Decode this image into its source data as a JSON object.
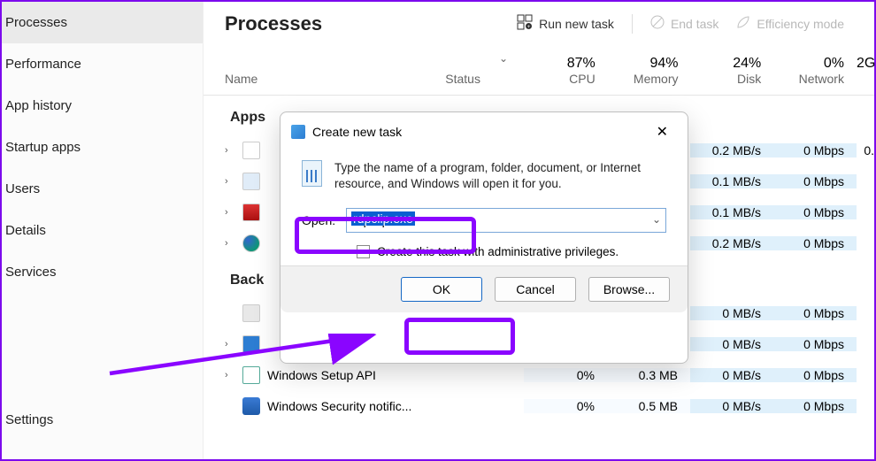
{
  "sidebar": {
    "items": [
      {
        "label": "Processes"
      },
      {
        "label": "Performance"
      },
      {
        "label": "App history"
      },
      {
        "label": "Startup apps"
      },
      {
        "label": "Users"
      },
      {
        "label": "Details"
      },
      {
        "label": "Services"
      },
      {
        "label": "Settings"
      }
    ]
  },
  "header": {
    "title": "Processes",
    "run_new_task": "Run new task",
    "end_task": "End task",
    "efficiency_mode": "Efficiency mode"
  },
  "columns": {
    "name": "Name",
    "status": "Status",
    "cpu_pct": "87%",
    "cpu": "CPU",
    "mem_pct": "94%",
    "mem": "Memory",
    "disk_pct": "24%",
    "disk": "Disk",
    "net_pct": "0%",
    "net": "Network",
    "gpu_pct": "2",
    "gpu": "G"
  },
  "groups": {
    "apps": "Apps",
    "background": "Back"
  },
  "rows_apps": [
    {
      "cpu": "",
      "mem": "",
      "disk": "0.2 MB/s",
      "net": "0 Mbps",
      "gpu": "0."
    },
    {
      "cpu": "",
      "mem": "",
      "disk": "0.1 MB/s",
      "net": "0 Mbps",
      "gpu": ""
    },
    {
      "cpu": "",
      "mem": "",
      "disk": "0.1 MB/s",
      "net": "0 Mbps",
      "gpu": ""
    },
    {
      "cpu": "",
      "mem": "",
      "disk": "0.2 MB/s",
      "net": "0 Mbps",
      "gpu": ""
    }
  ],
  "rows_bg": [
    {
      "name": "",
      "cpu": "",
      "mem": "",
      "disk": "0 MB/s",
      "net": "0 Mbps",
      "gpu": ""
    },
    {
      "name": "",
      "cpu": "",
      "mem": "",
      "disk": "0 MB/s",
      "net": "0 Mbps",
      "gpu": ""
    },
    {
      "name": "Windows Setup API",
      "cpu": "0%",
      "mem": "0.3 MB",
      "disk": "0 MB/s",
      "net": "0 Mbps",
      "gpu": ""
    },
    {
      "name": "Windows Security notific...",
      "cpu": "0%",
      "mem": "0.5 MB",
      "disk": "0 MB/s",
      "net": "0 Mbps",
      "gpu": ""
    }
  ],
  "dialog": {
    "title": "Create new task",
    "message": "Type the name of a program, folder, document, or Internet resource, and Windows will open it for you.",
    "open_label": "Open:",
    "open_value": "rdpclip.exe",
    "admin_label": "Create this task with administrative privileges.",
    "ok": "OK",
    "cancel": "Cancel",
    "browse": "Browse..."
  }
}
